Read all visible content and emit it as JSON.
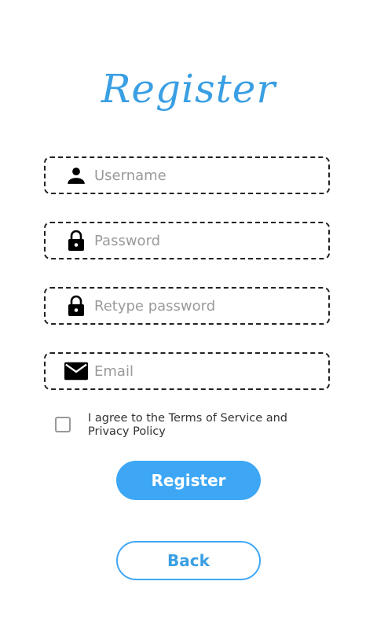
{
  "title": "Register",
  "fields": [
    {
      "placeholder": "Username",
      "icon": "person-icon"
    },
    {
      "placeholder": "Password",
      "icon": "lock-icon"
    },
    {
      "placeholder": "Retype password",
      "icon": "lock-icon"
    },
    {
      "placeholder": "Email",
      "icon": "mail-icon"
    }
  ],
  "agreement": {
    "checked": false,
    "text": "I agree to the Terms of Service and Privacy Policy"
  },
  "buttons": {
    "register_label": "Register",
    "back_label": "Back"
  },
  "colors": {
    "accent": "#3ea7f5",
    "title": "#3a9fe3"
  }
}
